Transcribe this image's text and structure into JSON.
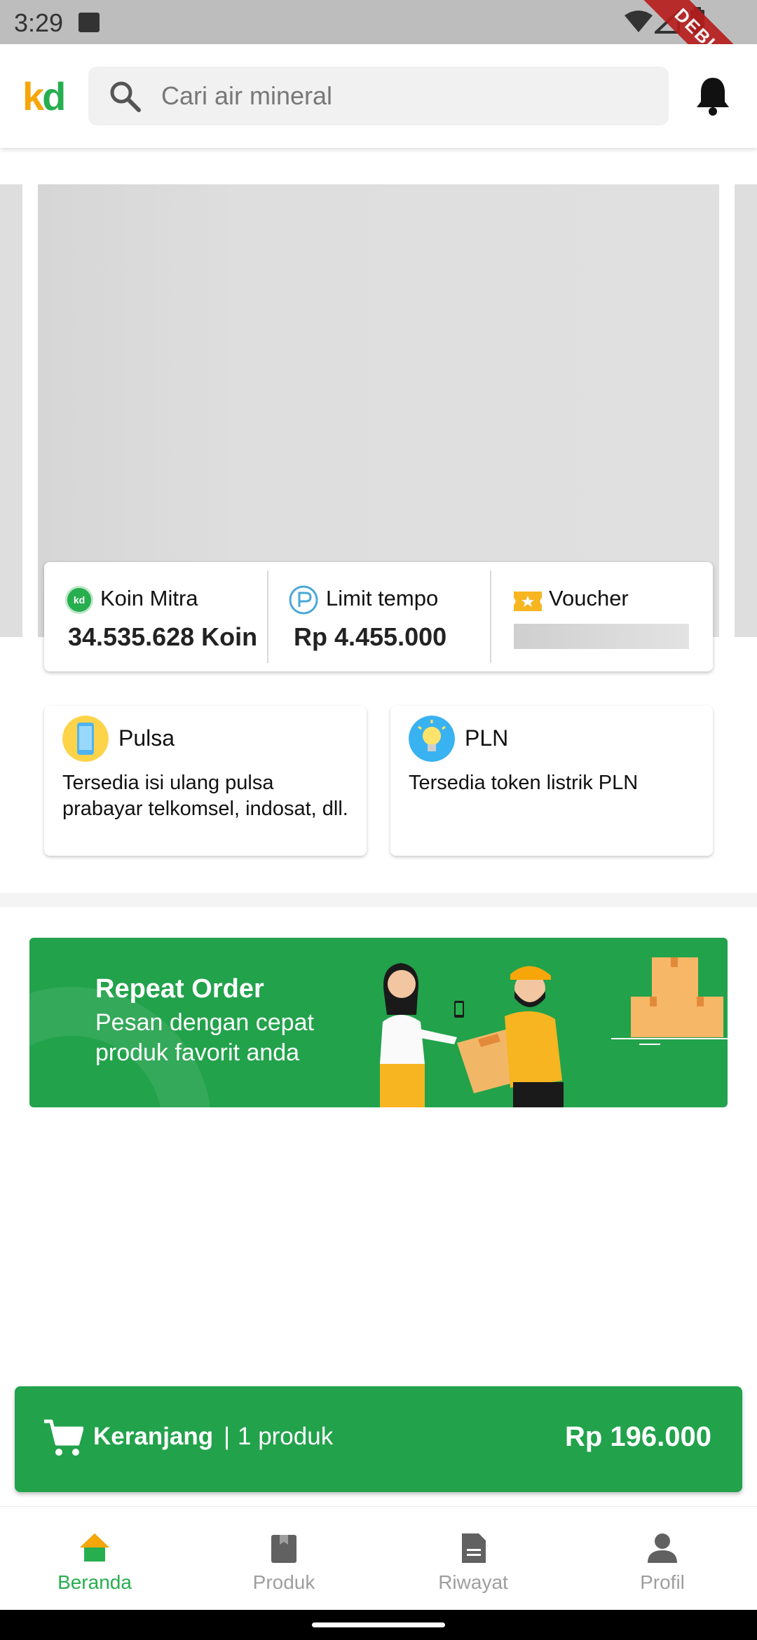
{
  "status_bar": {
    "time": "3:29",
    "debug_label": "DEBUG"
  },
  "app_bar": {
    "logo_k": "k",
    "logo_d": "d",
    "search_placeholder": "Cari air mineral"
  },
  "info_card": {
    "koin": {
      "title": "Koin Mitra",
      "value": "34.535.628 Koin",
      "icon_text": "kd"
    },
    "limit": {
      "title": "Limit tempo",
      "value": "Rp 4.455.000"
    },
    "voucher": {
      "title": "Voucher"
    }
  },
  "services": [
    {
      "title": "Pulsa",
      "description": "Tersedia isi ulang pulsa prabayar telkomsel, indosat, dll.",
      "icon": "phone-icon"
    },
    {
      "title": "PLN",
      "description": "Tersedia token listrik PLN",
      "icon": "lightbulb-icon"
    }
  ],
  "banner": {
    "title": "Repeat Order",
    "subtitle": "Pesan dengan cepat produk favorit anda"
  },
  "cart": {
    "label": "Keranjang",
    "separator": "|",
    "count": "1 produk",
    "total": "Rp 196.000"
  },
  "bottom_nav": [
    {
      "label": "Beranda",
      "icon": "home-icon",
      "active": true
    },
    {
      "label": "Produk",
      "icon": "box-icon",
      "active": false
    },
    {
      "label": "Riwayat",
      "icon": "document-icon",
      "active": false
    },
    {
      "label": "Profil",
      "icon": "person-icon",
      "active": false
    }
  ],
  "colors": {
    "primary_green": "#22a24b",
    "logo_orange": "#f6a609",
    "inactive_gray": "#9e9e9e"
  }
}
